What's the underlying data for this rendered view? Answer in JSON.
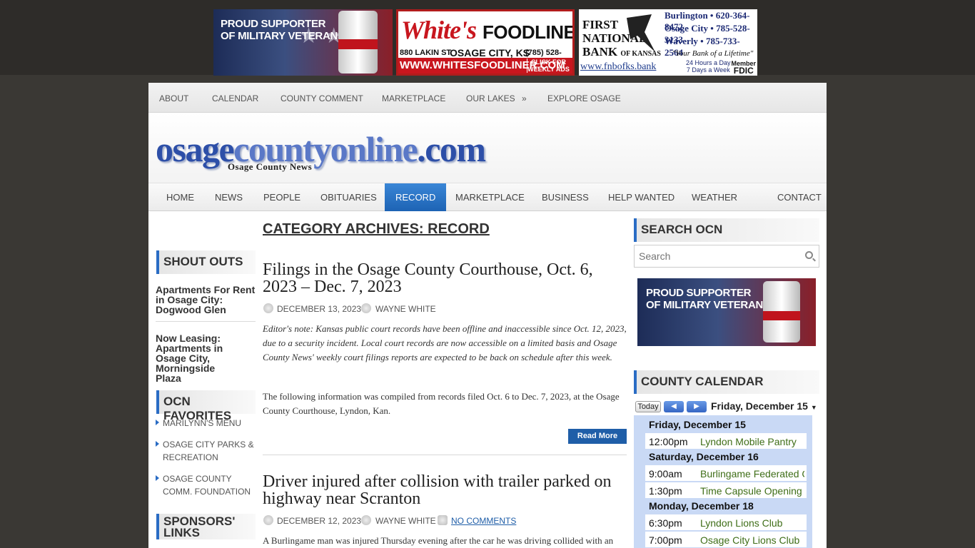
{
  "ads": {
    "veterans": {
      "line1": "PROUD SUPPORTER",
      "line2": "OF MILITARY VETERANS"
    },
    "whites": {
      "brand": "White's",
      "brand2": "FOODLINER",
      "address": "880 LAKIN ST.",
      "city": "OSAGE CITY, KS",
      "phone": "(785) 528-3065",
      "web": "WWW.WHITESFOODLINER.COM",
      "click": "CLICK FOR WEEKLY ADS"
    },
    "bank": {
      "l1": "FIRST",
      "l2": "NATIONAL",
      "l3": "BANK",
      "l3b": "OF KANSAS",
      "loc1": "Burlington • 620-364-8472",
      "loc2": "Osage City • 785-528-3133",
      "loc3": "Waverly • 785-733-2564",
      "slogan": "\"Your Bank of a Lifetime\"",
      "hours1": "24 Hours a Day",
      "hours2": "7 Days a Week",
      "url": "www.fnbofks.bank",
      "member": "Member",
      "fdic": "FDIC"
    }
  },
  "topnav": [
    "ABOUT",
    "CALENDAR",
    "COUNTY COMMENT",
    "MARKETPLACE",
    "OUR LAKES",
    "EXPLORE OSAGE"
  ],
  "header": {
    "logo_a": "osage",
    "logo_b": "countyonline",
    "logo_c": ".com",
    "tagline": "Osage County News"
  },
  "mainnav": [
    "HOME",
    "NEWS",
    "PEOPLE",
    "OBITUARIES",
    "RECORD",
    "MARKETPLACE",
    "BUSINESS",
    "HELP WANTED",
    "WEATHER",
    "CONTACT"
  ],
  "left": {
    "shoutouts_title": "SHOUT OUTS",
    "shout1": "Apartments For Rent in Osage City: Dogwood Glen",
    "shout2": "Now Leasing: Apartments in Osage City, Morningside Plaza",
    "favorites_title": "OCN FAVORITES",
    "fav1": "MARILYNN'S MENU",
    "fav2": "OSAGE CITY PARKS & RECREATION",
    "fav3": "OSAGE COUNTY COMM. FOUNDATION",
    "sponsors_title": "SPONSORS' LINKS"
  },
  "content": {
    "category_title": "CATEGORY ARCHIVES: RECORD",
    "post1": {
      "title": "Filings in the Osage County Courthouse, Oct. 6, 2023 – Dec. 7, 2023",
      "date": "DECEMBER 13, 2023",
      "author": "WAYNE WHITE",
      "editor_note": "Editor's note: Kansas public court records have been offline and inaccessible since Oct. 12, 2023, due to a security incident. Local court records are now accessible on a limited basis and Osage County News' weekly court filings reports are expected to be back on schedule after this week.",
      "body": "The following information was compiled from records filed Oct. 6 to Dec. 7, 2023, at the Osage County Courthouse, Lyndon, Kan.",
      "read_more": "Read More"
    },
    "post2": {
      "title": "Driver injured after collision with trailer parked on highway near Scranton",
      "date": "DECEMBER 12, 2023",
      "author": "WAYNE WHITE",
      "comments": "NO COMMENTS",
      "body": "A Burlingame man was injured Thursday evening after the car he was driving collided with an"
    }
  },
  "right": {
    "search_title": "SEARCH OCN",
    "search_placeholder": "Search",
    "calendar_title": "COUNTY CALENDAR",
    "calendar": {
      "today": "Today",
      "current": "Friday, December 15",
      "days": [
        {
          "label": "Friday, December 15",
          "events": [
            {
              "time": "12:00pm",
              "name": "Lyndon Mobile Pantry"
            }
          ]
        },
        {
          "label": "Saturday, December 16",
          "events": [
            {
              "time": "9:00am",
              "name": "Burlingame Federated Church"
            },
            {
              "time": "1:30pm",
              "name": "Time Capsule Opening"
            }
          ]
        },
        {
          "label": "Monday, December 18",
          "events": [
            {
              "time": "6:30pm",
              "name": "Lyndon Lions Club"
            },
            {
              "time": "7:00pm",
              "name": "Osage City Lions Club"
            }
          ]
        }
      ]
    }
  }
}
